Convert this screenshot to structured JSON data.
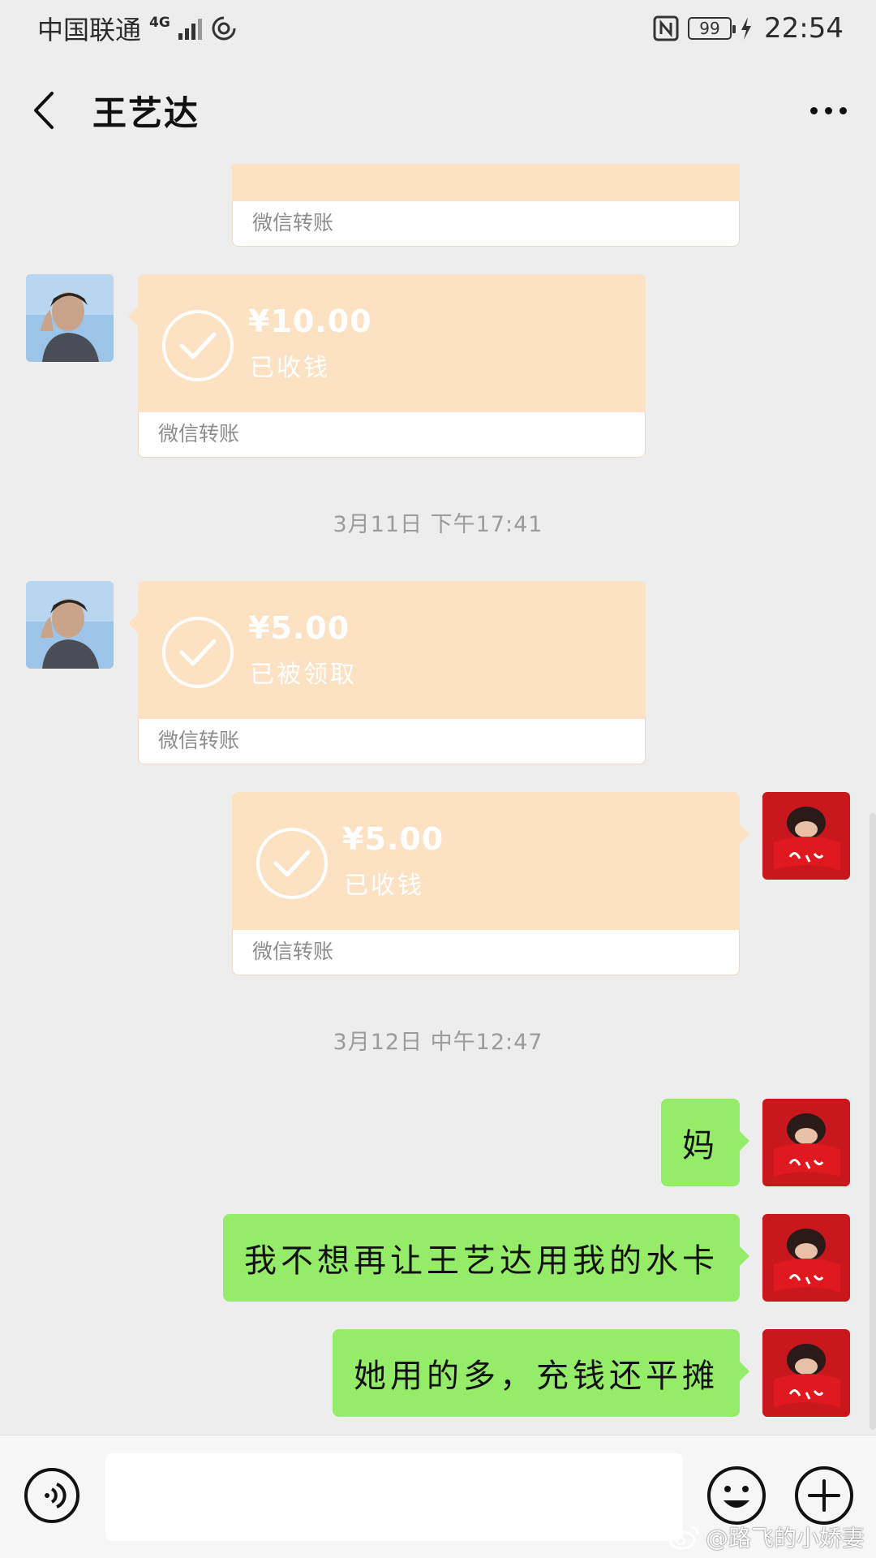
{
  "status_bar": {
    "carrier": "中国联通",
    "network": "4G",
    "battery": "99",
    "time": "22:54"
  },
  "header": {
    "title": "王艺达"
  },
  "messages": {
    "transfer_0": {
      "label": "微信转账"
    },
    "transfer_1": {
      "amount": "¥10.00",
      "status": "已收钱",
      "label": "微信转账"
    },
    "timestamp_1": "3月11日 下午17:41",
    "transfer_2": {
      "amount": "¥5.00",
      "status": "已被领取",
      "label": "微信转账"
    },
    "transfer_3": {
      "amount": "¥5.00",
      "status": "已收钱",
      "label": "微信转账"
    },
    "timestamp_2": "3月12日 中午12:47",
    "text_1": "妈",
    "text_2": "我不想再让王艺达用我的水卡",
    "text_3": "她用的多，充钱还平摊"
  },
  "input_bar": {
    "value": ""
  },
  "watermark": {
    "text": "@路飞的小娇妻"
  },
  "colors": {
    "transfer_bg": "#fde1c3",
    "sent_bubble": "#95ec69",
    "background": "#ededed"
  },
  "icons": [
    "back-arrow-icon",
    "more-dots-icon",
    "check-circle-icon",
    "voice-icon",
    "emoji-icon",
    "plus-icon",
    "weibo-icon"
  ]
}
